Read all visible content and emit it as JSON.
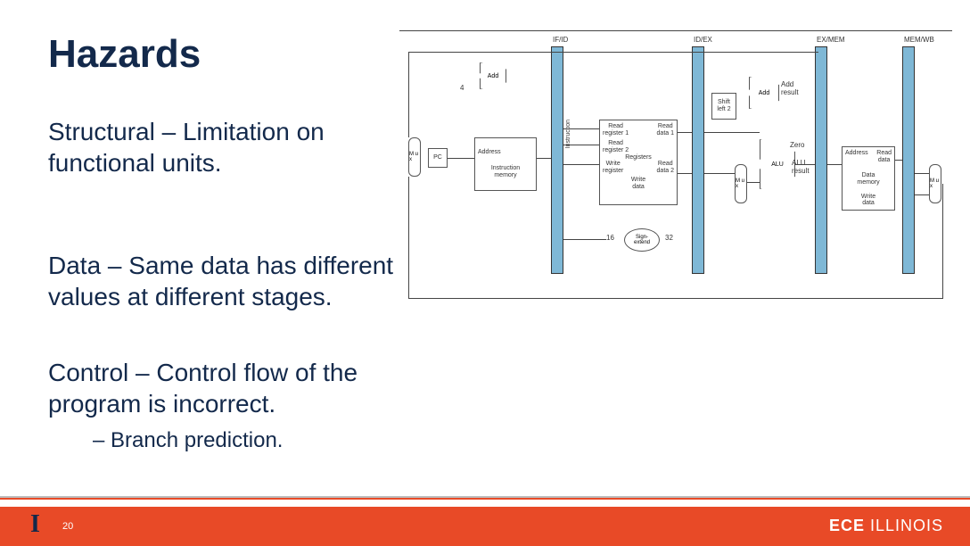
{
  "title": "Hazards",
  "paragraphs": {
    "p1": "Structural – Limitation on functional units.",
    "p2": "Data – Same data has different values at different stages.",
    "p3": "Control – Control flow of the program is incorrect."
  },
  "sub_bullet": "Branch prediction.",
  "footer": {
    "logo": "I",
    "page": "20",
    "dept": "ECE",
    "school": "ILLINOIS"
  },
  "diagram": {
    "stage_labels": [
      "IF/ID",
      "ID/EX",
      "EX/MEM",
      "MEM/WB"
    ],
    "blocks": {
      "pc": "PC",
      "imem": "Instruction\nmemory",
      "imem_addr": "Address",
      "regfile": "Registers",
      "read_reg1": "Read\nregister 1",
      "read_reg2": "Read\nregister 2",
      "write_reg": "Write\nregister",
      "write_data": "Write\ndata",
      "read_data1": "Read\ndata 1",
      "read_data2": "Read\ndata 2",
      "alu": "ALU",
      "alu_result": "ALU\nresult",
      "zero": "Zero",
      "dmem": "Data\nmemory",
      "dmem_addr": "Address",
      "dmem_rd": "Read\ndata",
      "dmem_wd": "Write\ndata",
      "adder1": "Add",
      "adder2": "Add",
      "add_result": "Add\nresult",
      "const4": "4",
      "shift": "Shift\nleft 2",
      "signext": "Sign-\nextend",
      "se_in": "16",
      "se_out": "32",
      "mux": "M\nu\nx",
      "instr_side": "Instruction"
    }
  }
}
